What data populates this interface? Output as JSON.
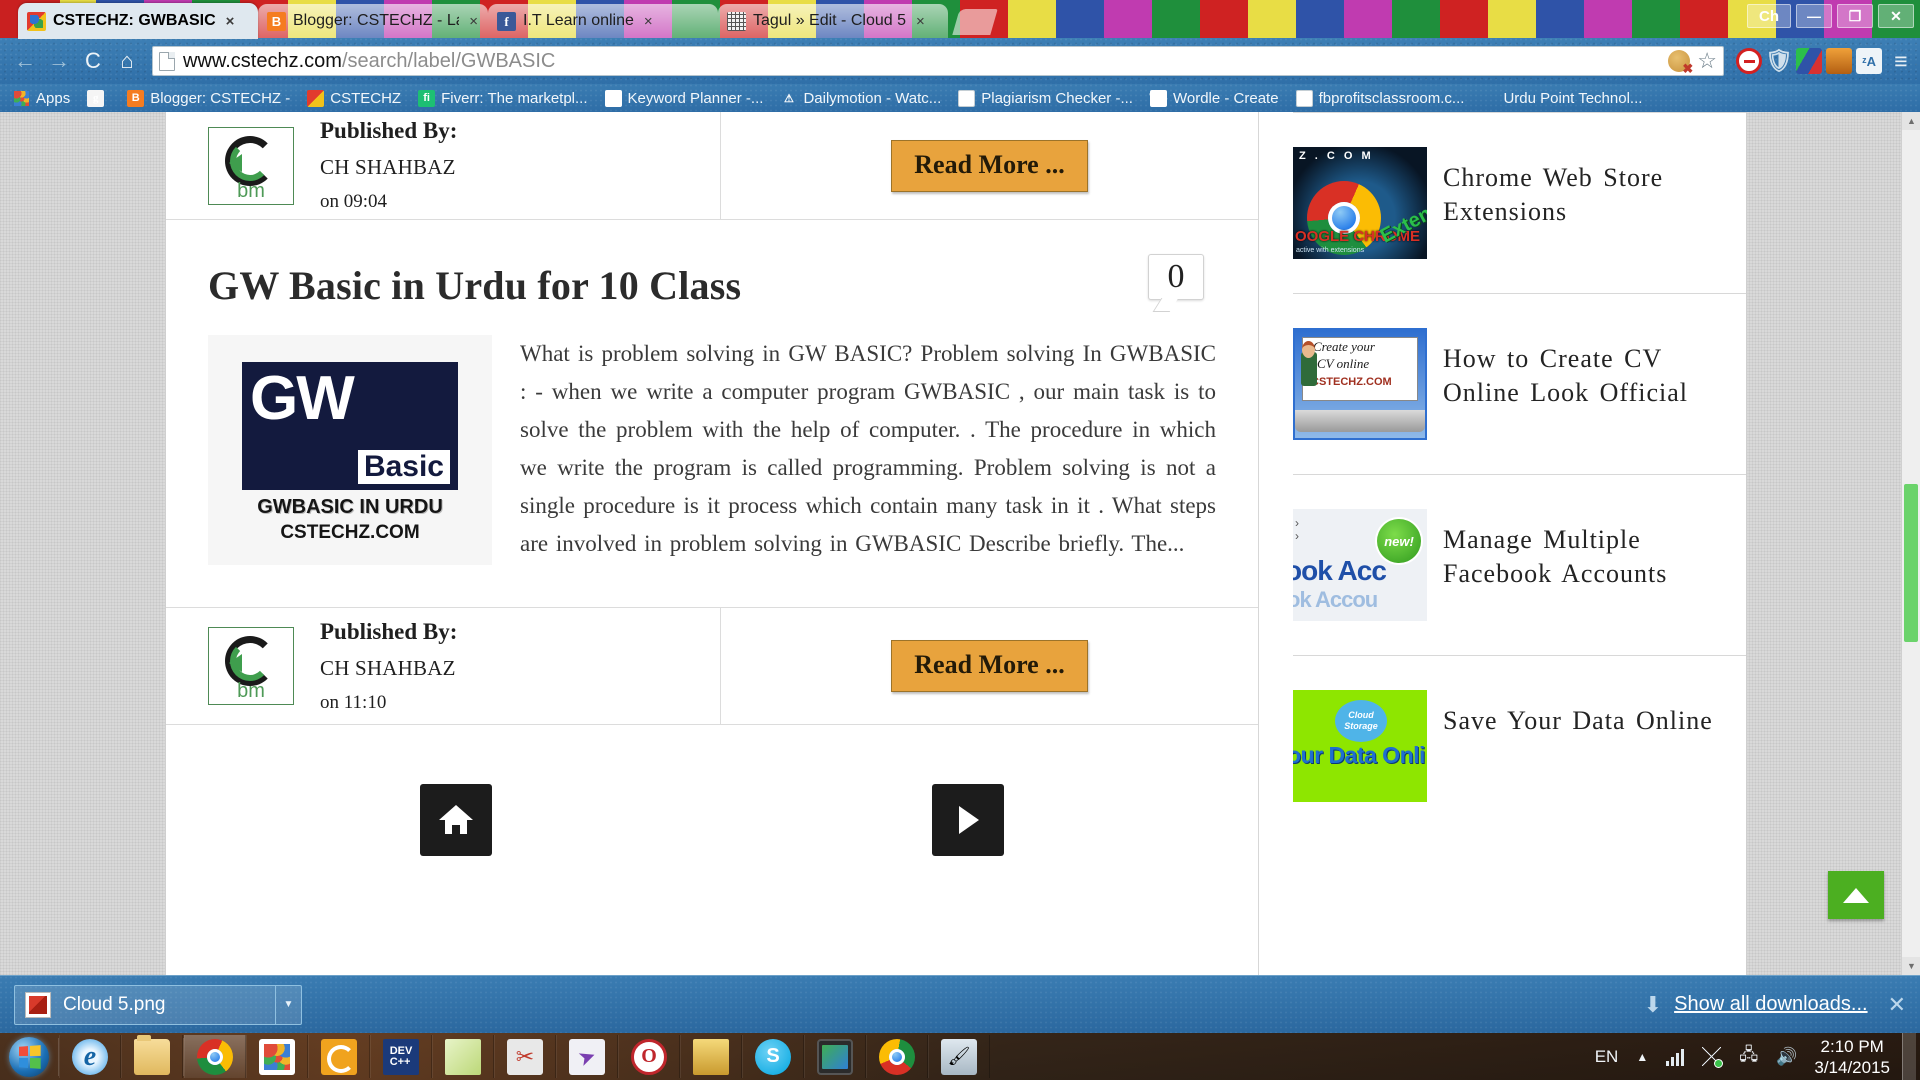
{
  "browser": {
    "tabs": [
      {
        "title": "CSTECHZ: GWBASIC",
        "favicon": "cstechz-icon",
        "active": true,
        "close": "×"
      },
      {
        "title": "Blogger: CSTECHZ - Layou",
        "favicon": "blogger-icon",
        "active": false,
        "close": "×"
      },
      {
        "title": "I.T Learn online",
        "favicon": "facebook-icon",
        "active": false,
        "close": "×"
      },
      {
        "title": "Tagul » Edit - Cloud 5",
        "favicon": "tagul-icon",
        "active": false,
        "close": "×"
      }
    ],
    "window_controls": {
      "profile": "Ch",
      "minimize": "—",
      "restore": "❐",
      "close": "✕"
    },
    "nav": {
      "back": "←",
      "forward": "→",
      "reload": "C",
      "home": "⌂"
    },
    "omnibox": {
      "url_domain": "www.cstechz.com",
      "url_path": "/search/label/GWBASIC",
      "page_icon": "page-icon",
      "cookie_blocked_icon": "cookie-blocked-icon",
      "bookmark_star": "☆"
    },
    "extensions": [
      "adblock-icon",
      "shield-icon",
      "colors-icon",
      "orange-icon",
      "translate-icon"
    ],
    "menu_icon": "≡",
    "bookmarks": [
      {
        "label": "Apps",
        "icon": "apps-grid-icon"
      },
      {
        "label": "",
        "icon": "google-g-icon"
      },
      {
        "label": "Blogger: CSTECHZ -",
        "icon": "blogger-icon"
      },
      {
        "label": "CSTECHZ",
        "icon": "cstechz-icon"
      },
      {
        "label": "Fiverr: The marketpl...",
        "icon": "fiverr-icon"
      },
      {
        "label": "Keyword Planner -...",
        "icon": "keyword-planner-icon"
      },
      {
        "label": "Dailymotion - Watc...",
        "icon": "warning-icon"
      },
      {
        "label": "Plagiarism Checker -...",
        "icon": "document-icon"
      },
      {
        "label": "Wordle - Create",
        "icon": "wordle-icon"
      },
      {
        "label": "fbprofitsclassroom.c...",
        "icon": "document-icon"
      },
      {
        "label": "Urdu Point Technol...",
        "icon": "none"
      }
    ]
  },
  "page": {
    "top_post_meta": {
      "published_label": "Published By:",
      "author": "CH SHAHBAZ",
      "time": "on 09:04",
      "read_more": "Read More ...",
      "logo_text": "bm"
    },
    "post": {
      "title": "GW Basic in Urdu for 10 Class",
      "comment_count": "0",
      "thumbnail": {
        "gw": "GW",
        "basic": "Basic",
        "line1": "GWBASIC IN URDU",
        "line2": "CSTECHZ.COM"
      },
      "excerpt": "What is  problem solving in GW BASIC?  Problem solving  In GWBASIC : - when we write a computer program GWBASIC , our main task is to solve the problem with the help of computer. . The procedure in which we write the program is called programming. Problem solving is not a single procedure is it process which contain many task in it . What steps are involved in problem solving in GWBASIC  Describe briefly.  The..."
    },
    "bottom_post_meta": {
      "published_label": "Published By:",
      "author": "CH SHAHBAZ",
      "time": "on 11:10",
      "read_more": "Read More ...",
      "logo_text": "bm"
    },
    "pager": {
      "home": "home-icon",
      "next": "next-arrow-icon"
    },
    "sidebar": [
      {
        "label": "Chrome Web Store Extensions",
        "thumb": "chrome-extensions-thumb",
        "thumb_text": {
          "top": "Z . C O M",
          "mid": "OOGLE CHROME",
          "small": "active with extensions",
          "corner": "Exten"
        }
      },
      {
        "label": "How to Create CV Online Look Official",
        "thumb": "create-cv-thumb",
        "thumb_text": {
          "l1": "Create your",
          "l2": "CV online",
          "l3": "CSTECHZ.COM"
        }
      },
      {
        "label": "Manage Multiple Facebook Accounts",
        "thumb": "facebook-accounts-thumb",
        "thumb_text": {
          "l1": "ook Acc",
          "l2": "ok Accou",
          "badge": "new!"
        }
      },
      {
        "label": "Save Your Data Online",
        "thumb": "save-data-thumb",
        "thumb_text": {
          "badge": "Cloud Storage",
          "l1": "our Data Onli"
        }
      }
    ],
    "scroll_to_top": "scroll-to-top-icon"
  },
  "download_shelf": {
    "file_name": "Cloud 5.png",
    "file_icon": "png-file-icon",
    "caret": "▼",
    "download_arrow": "⬇",
    "show_all": "Show all downloads...",
    "close": "✕"
  },
  "taskbar": {
    "start": "windows-start-orb",
    "apps": [
      {
        "icon": "internet-explorer-icon",
        "active": false
      },
      {
        "icon": "file-explorer-icon",
        "active": false
      },
      {
        "icon": "google-chrome-icon",
        "active": true
      },
      {
        "icon": "app-grid-icon",
        "active": false
      },
      {
        "icon": "camtasia-icon",
        "active": false
      },
      {
        "icon": "dev-cpp-icon",
        "active": false
      },
      {
        "icon": "sticky-notes-icon",
        "active": false
      },
      {
        "icon": "snipping-tool-icon",
        "active": false
      },
      {
        "icon": "paper-plane-icon",
        "active": false
      },
      {
        "icon": "opera-icon",
        "active": false
      },
      {
        "icon": "books-icon",
        "active": false
      },
      {
        "icon": "skype-icon",
        "active": false
      },
      {
        "icon": "phone-icon",
        "active": false
      },
      {
        "icon": "chrome-canary-icon",
        "active": false
      },
      {
        "icon": "paint-icon",
        "active": false
      }
    ],
    "tray": {
      "language": "EN",
      "show_hidden": "▲",
      "network_icon": "signal-bars-icon",
      "dropbox_icon": "dropbox-icon",
      "action_center_icon": "action-center-icon",
      "volume_icon": "volume-icon",
      "time": "2:10 PM",
      "date": "3/14/2015"
    }
  },
  "colors": {
    "chrome_frame": "#2f6fa8",
    "read_more_bg": "#e8a33d",
    "scroll_thumb": "#6bd36b",
    "to_top_bg": "#4caf21"
  }
}
